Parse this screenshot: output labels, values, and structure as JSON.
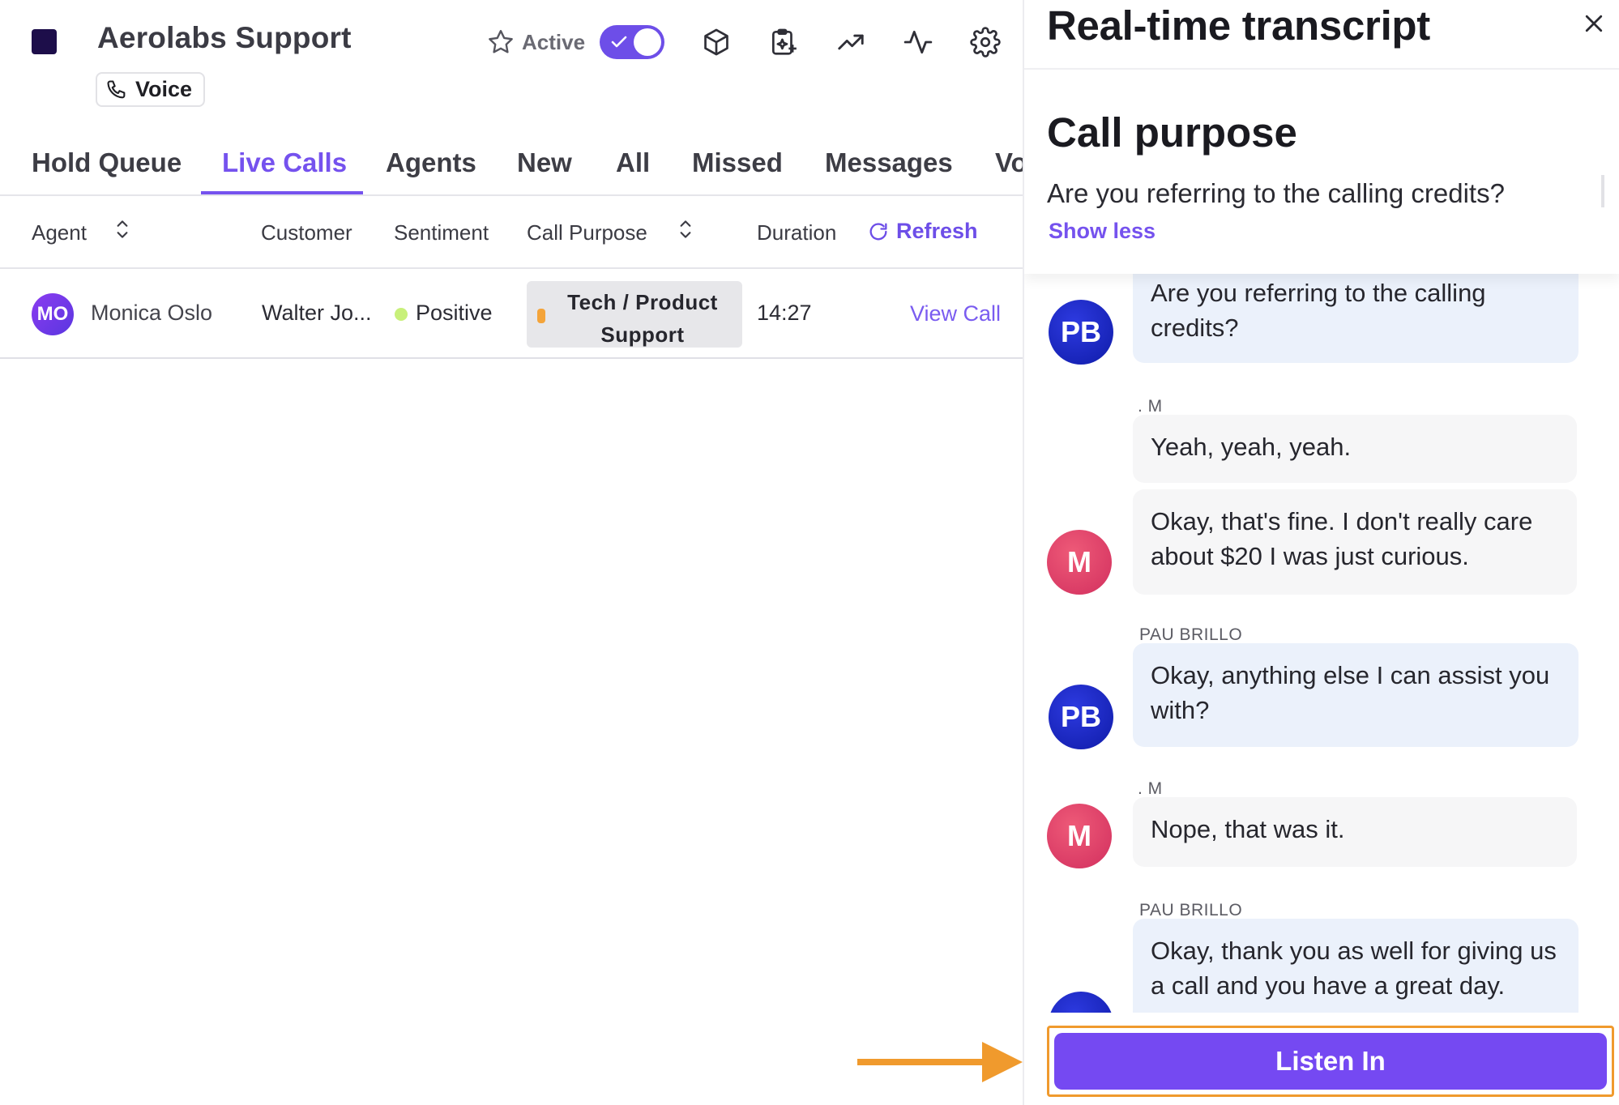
{
  "app": {
    "title": "Aerolabs Support",
    "channel": "Voice",
    "status_label": "Active",
    "status_on": true,
    "accent_color": "#7552ee"
  },
  "tabs": [
    "Hold Queue",
    "Live Calls",
    "Agents",
    "New",
    "All",
    "Missed",
    "Messages",
    "Vo"
  ],
  "active_tab": "Live Calls",
  "table": {
    "columns": {
      "agent": "Agent",
      "customer": "Customer",
      "sentiment": "Sentiment",
      "call_purpose": "Call Purpose",
      "duration": "Duration"
    },
    "refresh_label": "Refresh",
    "rows": [
      {
        "agent_initials": "MO",
        "agent_name": "Monica Oslo",
        "customer": "Walter Jo...",
        "sentiment": "Positive",
        "call_purpose": "Tech / Product Support",
        "duration": "14:27",
        "action": "View Call"
      }
    ]
  },
  "transcript": {
    "title": "Real-time transcript",
    "purpose_heading": "Call purpose",
    "purpose_text": "Are you referring to the calling credits?",
    "show_less": "Show less",
    "messages": [
      {
        "avatar": "PB",
        "speaker": "",
        "text": "Are you referring to the calling credits?"
      },
      {
        "avatar": "",
        "speaker": ". M",
        "text": "Yeah, yeah, yeah."
      },
      {
        "avatar": "M",
        "speaker": "",
        "text": "Okay, that's fine. I don't really care about $20 I was just curious."
      },
      {
        "avatar": "PB",
        "speaker": "PAU BRILLO",
        "text": "Okay, anything else I can assist you with?"
      },
      {
        "avatar": "M",
        "speaker": ". M",
        "text": "Nope, that was it."
      },
      {
        "avatar": "PB",
        "speaker": "PAU BRILLO",
        "text": "Okay, thank you as well for giving us a call and you have a great day."
      }
    ],
    "listen_in": "Listen In"
  },
  "icons": [
    "star-icon",
    "check-icon",
    "cube-icon",
    "ai-clipboard-icon",
    "trending-up-icon",
    "activity-icon",
    "gear-icon",
    "phone-icon",
    "sort-icon",
    "refresh-icon",
    "close-icon",
    "arrow-icon"
  ]
}
